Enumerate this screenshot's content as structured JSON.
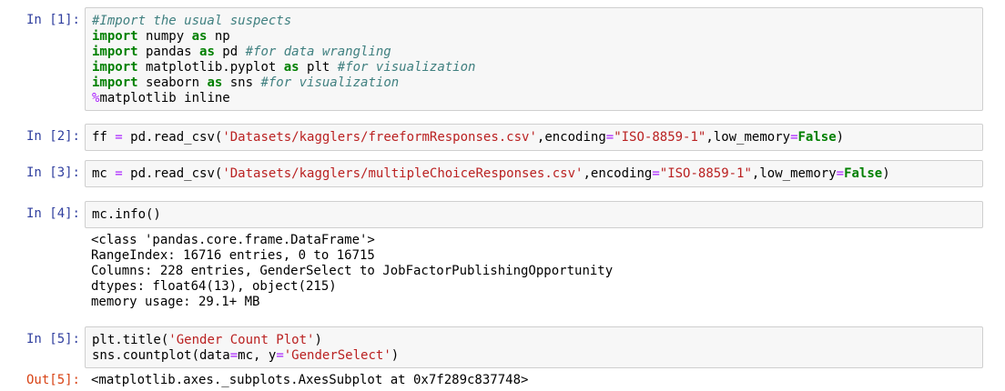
{
  "cells": [
    {
      "prompt": "In [1]:",
      "lines": [
        [
          {
            "t": "#Import the usual suspects",
            "c": "cm"
          }
        ],
        [
          {
            "t": "import",
            "c": "kw"
          },
          {
            "t": " numpy ",
            "c": "tok"
          },
          {
            "t": "as",
            "c": "kw"
          },
          {
            "t": " np",
            "c": "tok"
          }
        ],
        [
          {
            "t": "import",
            "c": "kw"
          },
          {
            "t": " pandas ",
            "c": "tok"
          },
          {
            "t": "as",
            "c": "kw"
          },
          {
            "t": " pd ",
            "c": "tok"
          },
          {
            "t": "#for data wrangling",
            "c": "cm"
          }
        ],
        [
          {
            "t": "import",
            "c": "kw"
          },
          {
            "t": " matplotlib.pyplot ",
            "c": "tok"
          },
          {
            "t": "as",
            "c": "kw"
          },
          {
            "t": " plt ",
            "c": "tok"
          },
          {
            "t": "#for visualization",
            "c": "cm"
          }
        ],
        [
          {
            "t": "import",
            "c": "kw"
          },
          {
            "t": " seaborn ",
            "c": "tok"
          },
          {
            "t": "as",
            "c": "kw"
          },
          {
            "t": " sns ",
            "c": "tok"
          },
          {
            "t": "#for visualization",
            "c": "cm"
          }
        ],
        [
          {
            "t": "%",
            "c": "magic-op"
          },
          {
            "t": "matplotlib inline",
            "c": "tok"
          }
        ]
      ]
    },
    {
      "prompt": "In [2]:",
      "lines": [
        [
          {
            "t": "ff ",
            "c": "tok"
          },
          {
            "t": "=",
            "c": "eq"
          },
          {
            "t": " pd.read_csv(",
            "c": "tok"
          },
          {
            "t": "'Datasets/kagglers/freeformResponses.csv'",
            "c": "st"
          },
          {
            "t": ",encoding",
            "c": "tok"
          },
          {
            "t": "=",
            "c": "eq"
          },
          {
            "t": "\"ISO-8859-1\"",
            "c": "st"
          },
          {
            "t": ",low_memory",
            "c": "tok"
          },
          {
            "t": "=",
            "c": "eq"
          },
          {
            "t": "False",
            "c": "bool"
          },
          {
            "t": ")",
            "c": "tok"
          }
        ]
      ]
    },
    {
      "prompt": "In [3]:",
      "lines": [
        [
          {
            "t": "mc ",
            "c": "tok"
          },
          {
            "t": "=",
            "c": "eq"
          },
          {
            "t": " pd.read_csv(",
            "c": "tok"
          },
          {
            "t": "'Datasets/kagglers/multipleChoiceResponses.csv'",
            "c": "st"
          },
          {
            "t": ",encoding",
            "c": "tok"
          },
          {
            "t": "=",
            "c": "eq"
          },
          {
            "t": "\"ISO-8859-1\"",
            "c": "st"
          },
          {
            "t": ",low_memory",
            "c": "tok"
          },
          {
            "t": "=",
            "c": "eq"
          },
          {
            "t": "False",
            "c": "bool"
          },
          {
            "t": ")",
            "c": "tok"
          }
        ]
      ]
    },
    {
      "prompt": "In [4]:",
      "lines": [
        [
          {
            "t": "mc.info()",
            "c": "tok"
          }
        ]
      ],
      "output": [
        "<class 'pandas.core.frame.DataFrame'>",
        "RangeIndex: 16716 entries, 0 to 16715",
        "Columns: 228 entries, GenderSelect to JobFactorPublishingOpportunity",
        "dtypes: float64(13), object(215)",
        "memory usage: 29.1+ MB"
      ]
    },
    {
      "prompt": "In [5]:",
      "lines": [
        [
          {
            "t": "plt.title(",
            "c": "tok"
          },
          {
            "t": "'Gender Count Plot'",
            "c": "st"
          },
          {
            "t": ")",
            "c": "tok"
          }
        ],
        [
          {
            "t": "sns.countplot(data",
            "c": "tok"
          },
          {
            "t": "=",
            "c": "eq"
          },
          {
            "t": "mc, y",
            "c": "tok"
          },
          {
            "t": "=",
            "c": "eq"
          },
          {
            "t": "'GenderSelect'",
            "c": "st"
          },
          {
            "t": ")",
            "c": "tok"
          }
        ]
      ],
      "out_prompt": "Out[5]:",
      "out_text": "<matplotlib.axes._subplots.AxesSubplot at 0x7f289c837748>"
    }
  ]
}
